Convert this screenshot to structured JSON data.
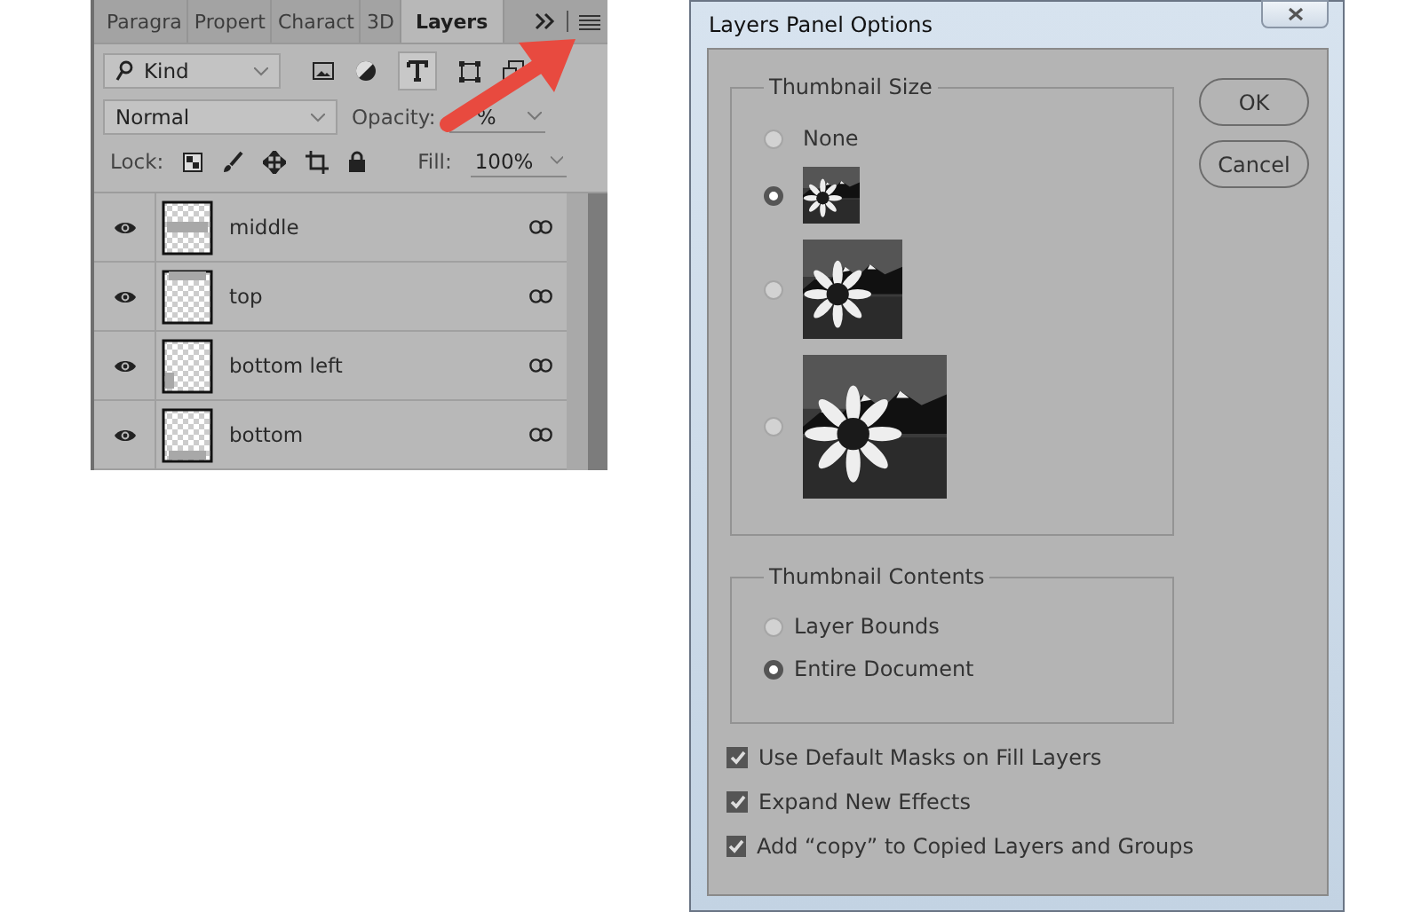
{
  "layers_panel": {
    "tabs": [
      {
        "label": "Paragra",
        "selected": false
      },
      {
        "label": "Propert",
        "selected": false
      },
      {
        "label": "Charact",
        "selected": false
      },
      {
        "label": "3D",
        "selected": false
      },
      {
        "label": "Layers",
        "selected": true
      }
    ],
    "filter": "Kind",
    "blend_mode": "Normal",
    "opacity_label": "Opacity:",
    "opacity_value": "%",
    "lock_label": "Lock:",
    "fill_label": "Fill:",
    "fill_value": "100%",
    "layers": [
      {
        "name": "middle",
        "visible": true,
        "kind": "middle"
      },
      {
        "name": "top",
        "visible": true,
        "kind": "top"
      },
      {
        "name": "bottom left",
        "visible": true,
        "kind": "bottom-left"
      },
      {
        "name": "bottom",
        "visible": true,
        "kind": "bottom"
      }
    ]
  },
  "dialog": {
    "title": "Layers Panel Options",
    "thumbnail_size": {
      "legend": "Thumbnail Size",
      "options": [
        {
          "kind": "text",
          "label": "None",
          "selected": false
        },
        {
          "kind": "picture",
          "selected": true
        },
        {
          "kind": "picture",
          "selected": false
        },
        {
          "kind": "picture",
          "selected": false
        }
      ]
    },
    "thumbnail_contents": {
      "legend": "Thumbnail Contents",
      "options": [
        {
          "label": "Layer Bounds",
          "selected": false
        },
        {
          "label": "Entire Document",
          "selected": true
        }
      ]
    },
    "checkboxes": [
      {
        "label": "Use Default Masks on Fill Layers",
        "checked": true
      },
      {
        "label": "Expand New Effects",
        "checked": true
      },
      {
        "label": "Add “copy” to Copied Layers and Groups",
        "checked": true
      }
    ],
    "buttons": [
      "OK",
      "Cancel"
    ]
  }
}
